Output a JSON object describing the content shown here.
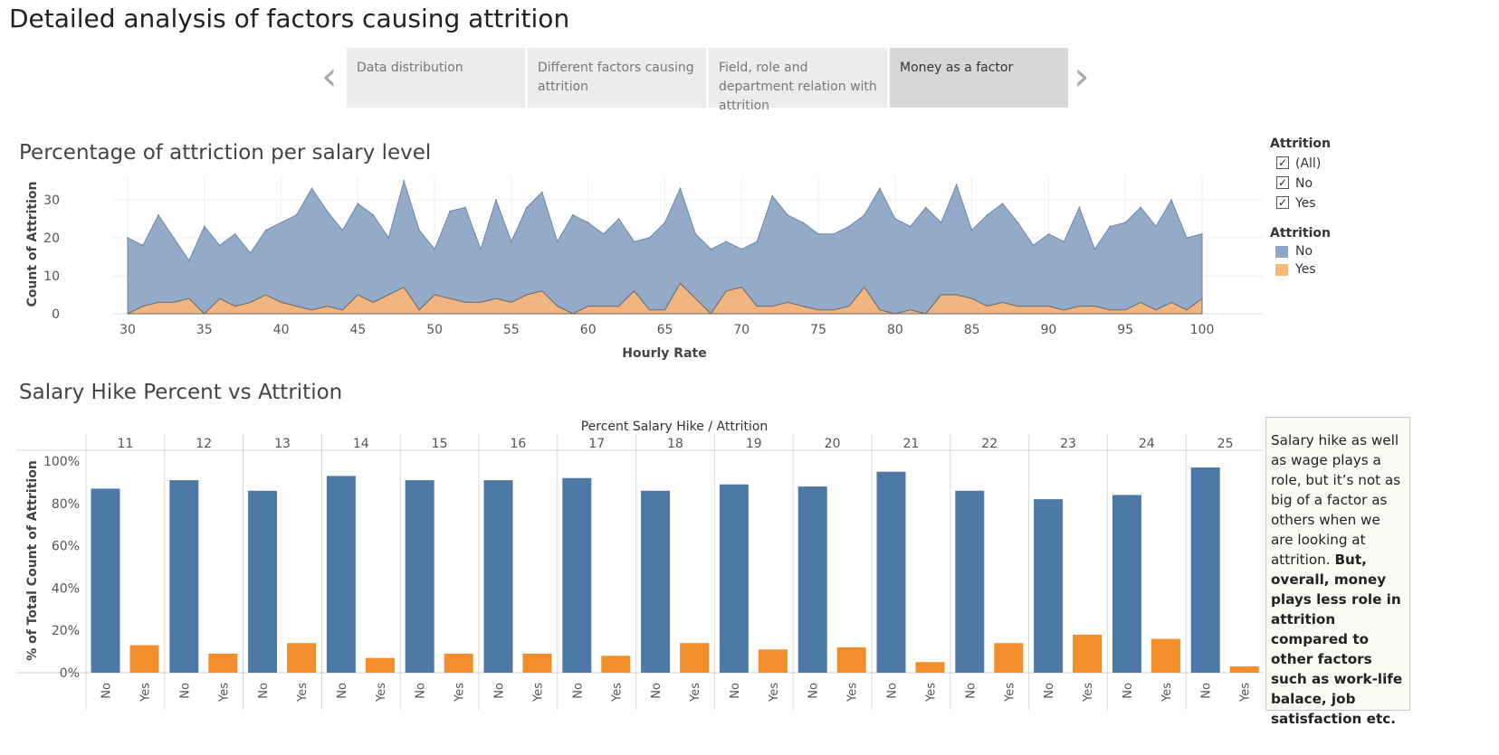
{
  "page": {
    "title": "Detailed analysis of factors causing attrition"
  },
  "tabs": [
    {
      "label": "Data distribution",
      "active": false
    },
    {
      "label": "Different factors causing attrition",
      "active": false
    },
    {
      "label": "Field, role and department relation with attrition",
      "active": false
    },
    {
      "label": "Money as a factor",
      "active": true
    }
  ],
  "nav": {
    "prev_icon": "chevron-left-icon",
    "next_icon": "chevron-right-icon"
  },
  "filter": {
    "header": "Attrition",
    "items": [
      {
        "label": "(All)",
        "checked": true
      },
      {
        "label": "No",
        "checked": true
      },
      {
        "label": "Yes",
        "checked": true
      }
    ]
  },
  "color_legend": {
    "header": "Attrition",
    "items": [
      {
        "label": "No",
        "color": "#8ca5c4"
      },
      {
        "label": "Yes",
        "color": "#f7b87a"
      }
    ]
  },
  "colors": {
    "no_area": "#7b98bd",
    "yes_area": "#f7b579",
    "no_bar": "#4e79a7",
    "yes_bar": "#f28e2b"
  },
  "chart_data": [
    {
      "type": "area",
      "title": "Percentage of attriction per salary level",
      "xlabel": "Hourly Rate",
      "ylabel": "Count of Attrition",
      "xlim": [
        30,
        100
      ],
      "ylim": [
        0,
        35
      ],
      "xticks": [
        "30",
        "35",
        "40",
        "45",
        "50",
        "55",
        "60",
        "65",
        "70",
        "75",
        "80",
        "85",
        "90",
        "95",
        "100"
      ],
      "yticks": [
        "0",
        "10",
        "20",
        "30"
      ],
      "x": [
        30,
        31,
        32,
        33,
        34,
        35,
        36,
        37,
        38,
        39,
        40,
        41,
        42,
        43,
        44,
        45,
        46,
        47,
        48,
        49,
        50,
        51,
        52,
        53,
        54,
        55,
        56,
        57,
        58,
        59,
        60,
        61,
        62,
        63,
        64,
        65,
        66,
        67,
        68,
        69,
        70,
        71,
        72,
        73,
        74,
        75,
        76,
        77,
        78,
        79,
        80,
        81,
        82,
        83,
        84,
        85,
        86,
        87,
        88,
        89,
        90,
        91,
        92,
        93,
        94,
        95,
        96,
        97,
        98,
        99,
        100
      ],
      "series": [
        {
          "name": "No",
          "values": [
            20,
            18,
            26,
            20,
            14,
            23,
            18,
            21,
            16,
            22,
            24,
            26,
            33,
            27,
            22,
            29,
            26,
            20,
            35,
            22,
            17,
            27,
            28,
            17,
            30,
            19,
            28,
            32,
            19,
            26,
            24,
            21,
            25,
            19,
            20,
            24,
            33,
            21,
            17,
            19,
            17,
            19,
            31,
            26,
            24,
            21,
            21,
            23,
            26,
            33,
            25,
            23,
            28,
            24,
            34,
            22,
            26,
            29,
            24,
            18,
            21,
            19,
            28,
            17,
            23,
            24,
            28,
            23,
            30,
            20,
            21
          ]
        },
        {
          "name": "Yes",
          "values": [
            0,
            2,
            3,
            3,
            4,
            0,
            4,
            2,
            3,
            5,
            3,
            2,
            1,
            2,
            1,
            5,
            3,
            5,
            7,
            1,
            5,
            4,
            3,
            3,
            4,
            3,
            5,
            6,
            2,
            0,
            2,
            2,
            2,
            6,
            1,
            1,
            8,
            4,
            0,
            6,
            7,
            2,
            2,
            3,
            2,
            1,
            1,
            2,
            7,
            1,
            0,
            1,
            0,
            5,
            5,
            4,
            2,
            3,
            2,
            2,
            2,
            1,
            2,
            2,
            1,
            1,
            3,
            1,
            3,
            1,
            4
          ]
        }
      ]
    },
    {
      "type": "bar",
      "title": "Salary Hike Percent vs Attrition",
      "header": "Percent Salary Hike  /  Attrition",
      "ylabel": "% of Total Count of Attrition",
      "ylim": [
        0,
        100
      ],
      "yticks": [
        "0%",
        "20%",
        "40%",
        "60%",
        "80%",
        "100%"
      ],
      "categories": [
        "11",
        "12",
        "13",
        "14",
        "15",
        "16",
        "17",
        "18",
        "19",
        "20",
        "21",
        "22",
        "23",
        "24",
        "25"
      ],
      "sub_categories": [
        "No",
        "Yes"
      ],
      "series": [
        {
          "name": "No",
          "values": [
            87,
            91,
            86,
            93,
            91,
            91,
            92,
            86,
            89,
            88,
            95,
            86,
            82,
            84,
            97
          ]
        },
        {
          "name": "Yes",
          "values": [
            13,
            9,
            14,
            7,
            9,
            9,
            8,
            14,
            11,
            12,
            5,
            14,
            18,
            16,
            3
          ]
        }
      ]
    }
  ],
  "note": {
    "text": "Salary hike as well as wage plays a role, but it’s not as big of a factor as others when we are looking at attrition.",
    "bold": "But, overall, money plays less role in attrition compared to other factors such as work-life balace, job satisfaction etc."
  }
}
